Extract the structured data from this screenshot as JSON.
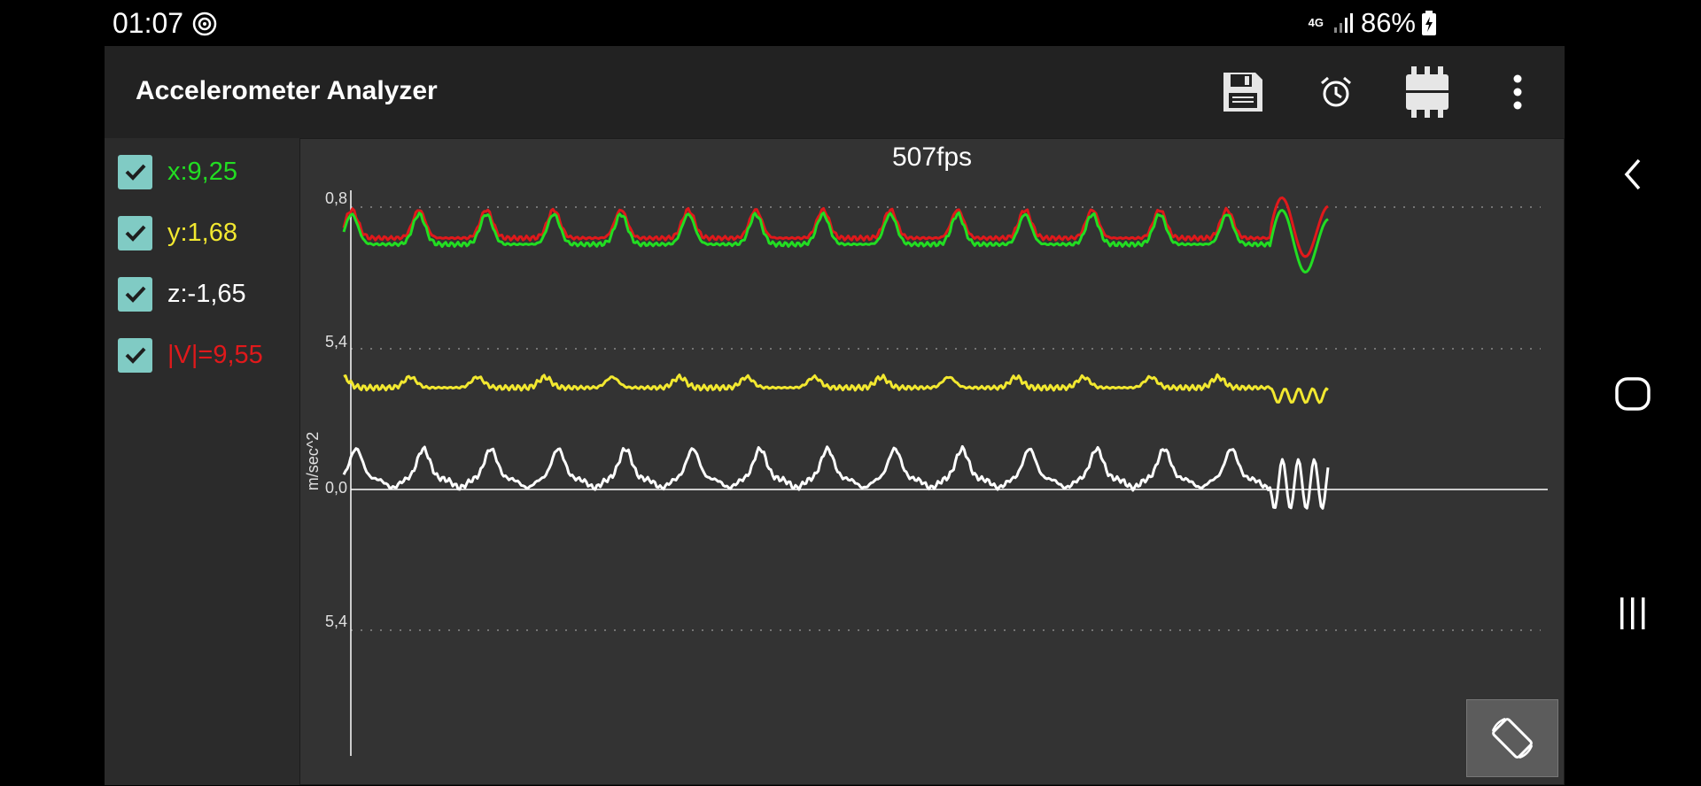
{
  "status_bar": {
    "time": "01:07",
    "network": "4G",
    "battery": "86%",
    "icons": [
      "record-icon",
      "signal-icon",
      "battery-charging-icon"
    ]
  },
  "app": {
    "title": "Accelerometer Analyzer",
    "toolbar_icons": [
      "save-icon",
      "alarm-icon",
      "chip-icon",
      "more-vert-icon"
    ]
  },
  "legend": [
    {
      "label": "x:9,25",
      "color": "#22dd22",
      "checked": true
    },
    {
      "label": "y:1,68",
      "color": "#f2e830",
      "checked": true
    },
    {
      "label": "z:-1,65",
      "color": "#ffffff",
      "checked": true
    },
    {
      "label": "|V|=9,55",
      "color": "#e0191b",
      "checked": true
    }
  ],
  "chart_data": {
    "type": "line",
    "title": "507fps",
    "ylabel": "m/sec^2",
    "ytick_labels": [
      "0,8",
      "5,4",
      "0,0",
      "5,4"
    ],
    "grid": true,
    "series": [
      {
        "name": "|V|",
        "color": "#e0191b"
      },
      {
        "name": "x",
        "color": "#22dd22"
      },
      {
        "name": "y",
        "color": "#f2e830"
      },
      {
        "name": "z",
        "color": "#ffffff"
      }
    ]
  },
  "nav_bar": {
    "icons": [
      "back-icon",
      "home-icon",
      "recents-icon"
    ]
  }
}
